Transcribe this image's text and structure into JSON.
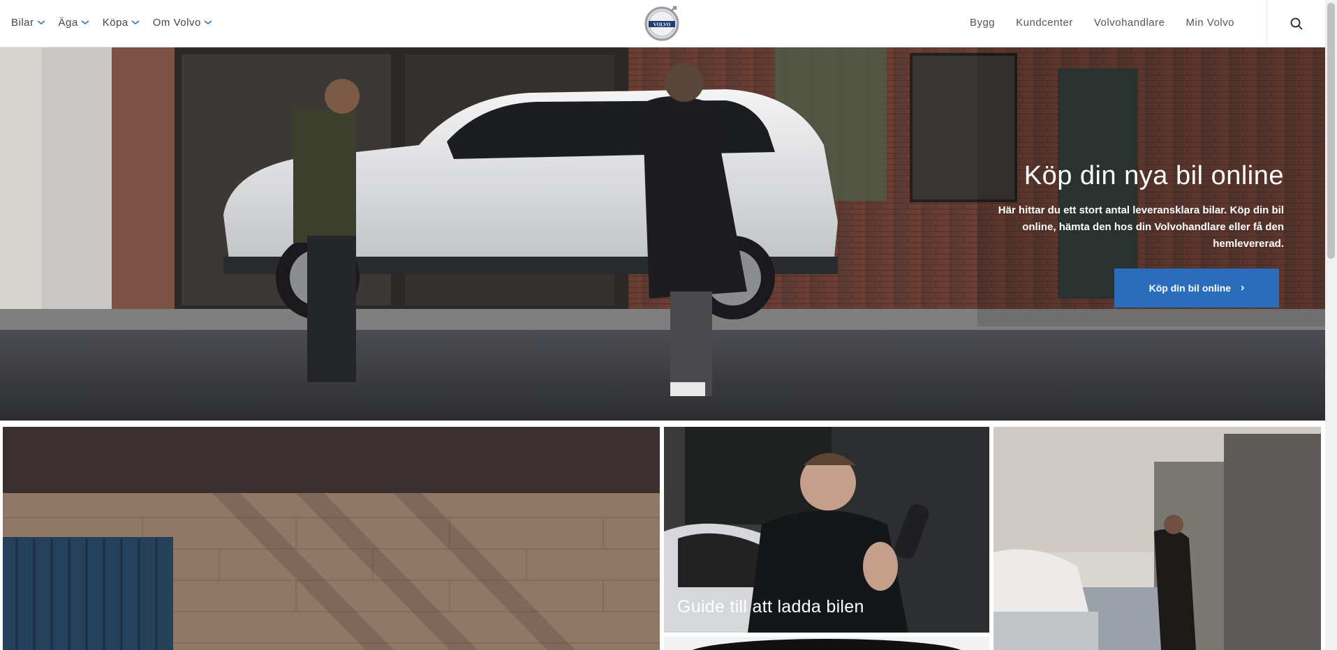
{
  "nav": {
    "left_items": [
      {
        "label": "Bilar"
      },
      {
        "label": "Äga"
      },
      {
        "label": "Köpa"
      },
      {
        "label": "Om Volvo"
      }
    ],
    "logo_text": "VOLVO",
    "right_items": [
      {
        "label": "Bygg"
      },
      {
        "label": "Kundcenter"
      },
      {
        "label": "Volvohandlare"
      },
      {
        "label": "Min Volvo"
      }
    ],
    "search_icon": "search-icon"
  },
  "hero": {
    "title": "Köp din nya bil online",
    "subtitle": "Här hittar du ett stort antal leveransklara bilar. Köp din bil online, hämta den hos din Volvohandlare eller få den hemlevererad.",
    "cta_label": "Köp din bil online",
    "cta_arrow": "›"
  },
  "tiles": [
    {
      "title": ""
    },
    {
      "title": "Guide till att ladda bilen"
    },
    {
      "title": ""
    }
  ],
  "colors": {
    "accent": "#2a6ebb",
    "chevron": "#2a6ebb",
    "text": "#444444"
  }
}
